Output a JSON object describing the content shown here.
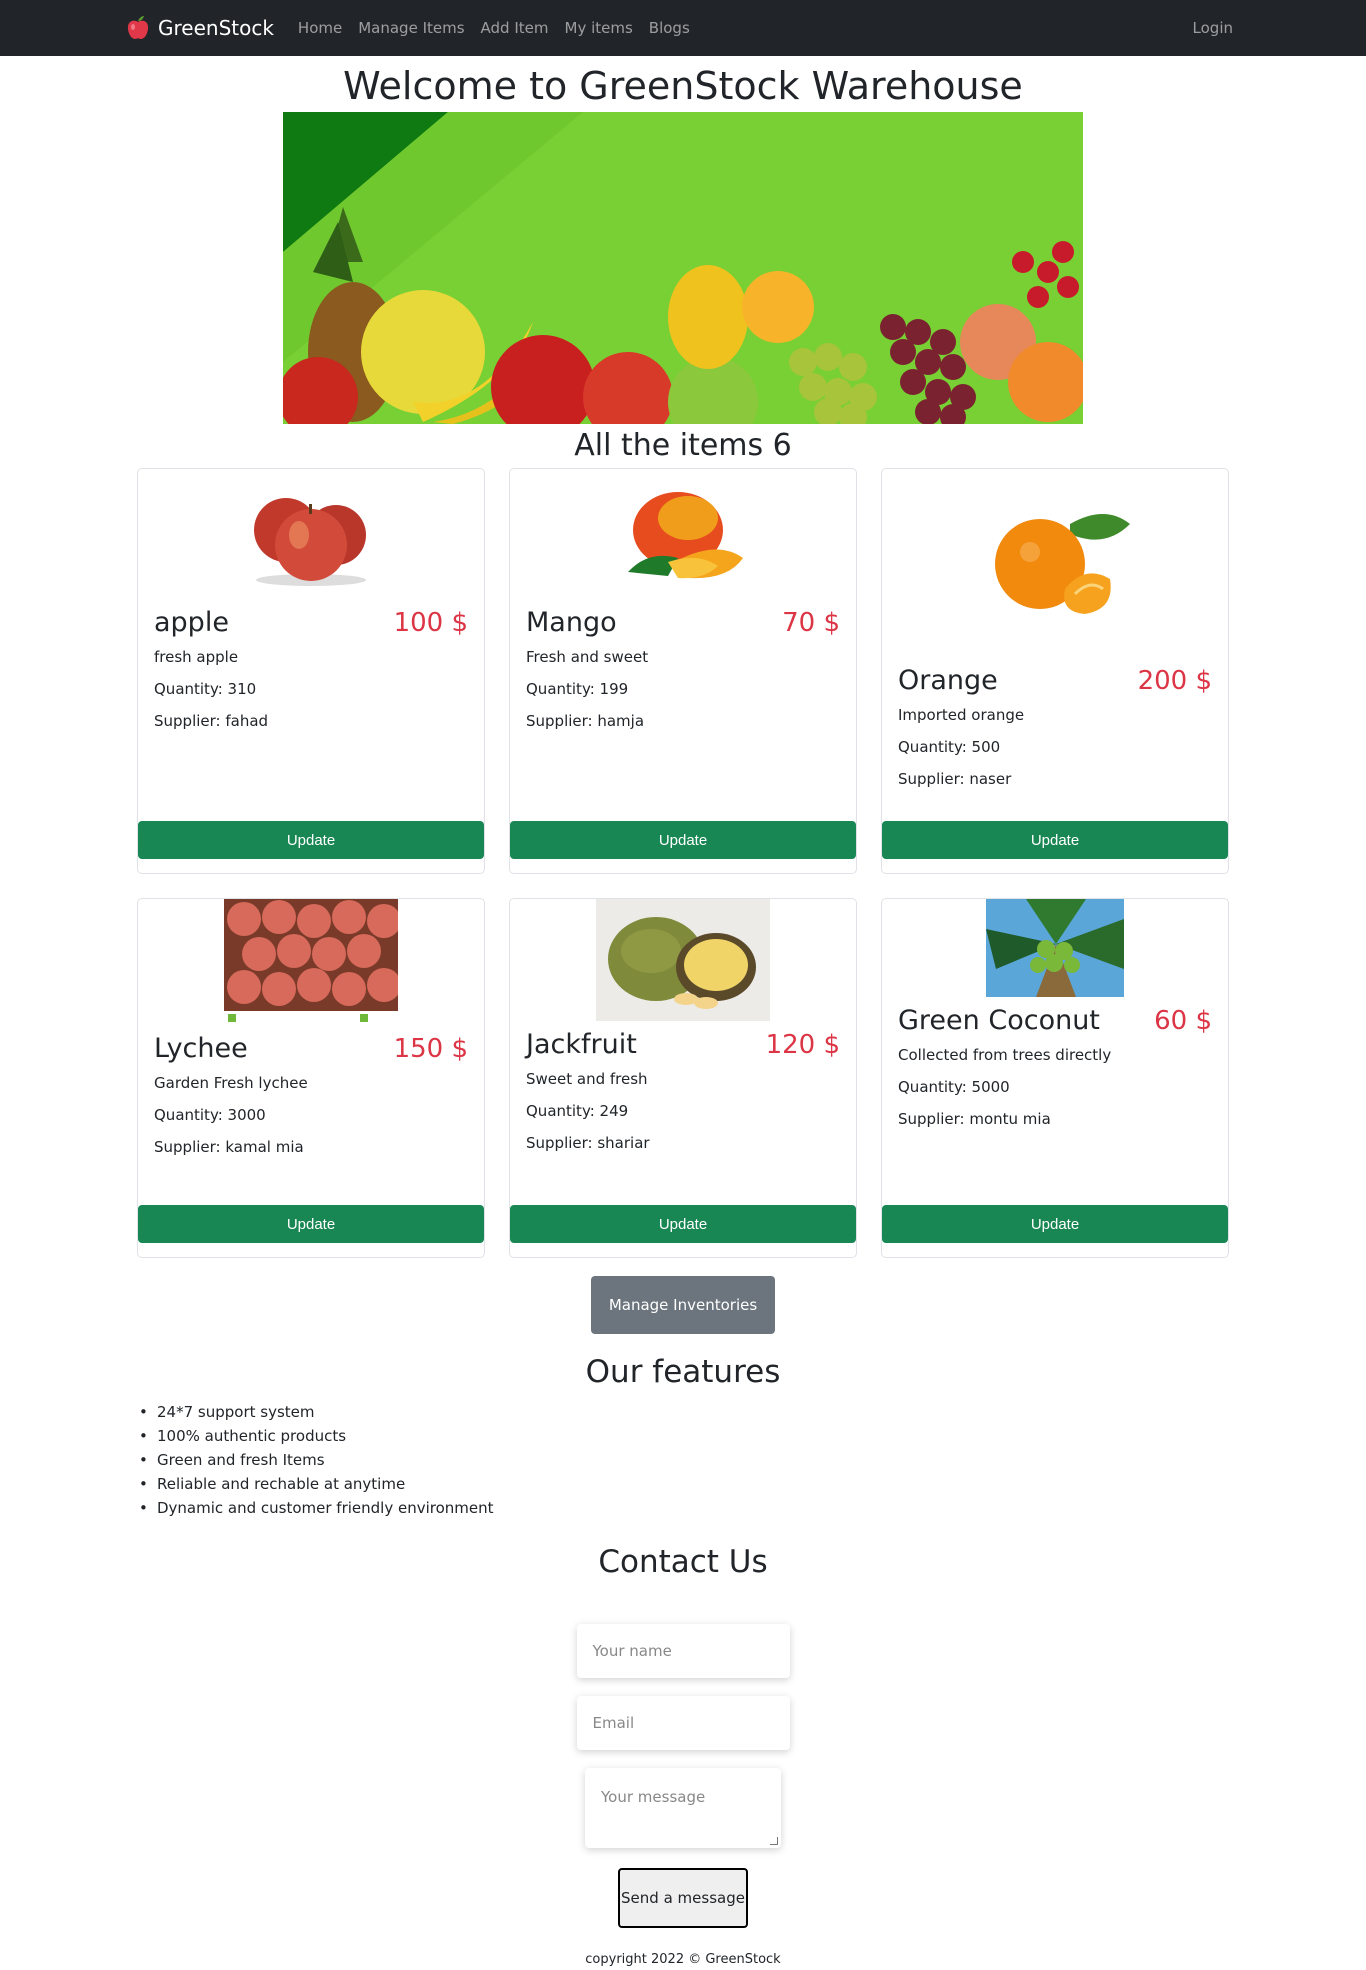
{
  "nav": {
    "brand": "GreenStock",
    "links": [
      "Home",
      "Manage Items",
      "Add Item",
      "My items",
      "Blogs"
    ],
    "login": "Login"
  },
  "hero": {
    "title": "Welcome to GreenStock Warehouse"
  },
  "items_section": {
    "title": "All the items 6"
  },
  "items": [
    {
      "name": "apple",
      "price": "100 $",
      "desc": "fresh apple",
      "qty": "Quantity: 310",
      "supplier": "Supplier: fahad",
      "button": "Update",
      "image": "apple"
    },
    {
      "name": "Mango",
      "price": "70 $",
      "desc": "Fresh and sweet",
      "qty": "Quantity: 199",
      "supplier": "Supplier: hamja",
      "button": "Update",
      "image": "mango"
    },
    {
      "name": "Orange",
      "price": "200 $",
      "desc": "Imported orange",
      "qty": "Quantity: 500",
      "supplier": "Supplier: naser",
      "button": "Update",
      "image": "orange"
    },
    {
      "name": "Lychee",
      "price": "150 $",
      "desc": "Garden Fresh lychee",
      "qty": "Quantity: 3000",
      "supplier": "Supplier: kamal mia",
      "button": "Update",
      "image": "lychee"
    },
    {
      "name": "Jackfruit",
      "price": "120 $",
      "desc": "Sweet and fresh",
      "qty": "Quantity: 249",
      "supplier": "Supplier: shariar",
      "button": "Update",
      "image": "jackfruit"
    },
    {
      "name": "Green Coconut",
      "price": "60 $",
      "desc": "Collected from trees directly",
      "qty": "Quantity: 5000",
      "supplier": "Supplier: montu mia",
      "button": "Update",
      "image": "coconut"
    }
  ],
  "manage_button": "Manage Inventories",
  "features": {
    "title": "Our features",
    "list": [
      "24*7 support system",
      "100% authentic products",
      "Green and fresh Items",
      "Reliable and rechable at anytime",
      "Dynamic and customer friendly environment"
    ]
  },
  "contact": {
    "title": "Contact Us",
    "name_placeholder": "Your name",
    "email_placeholder": "Email",
    "message_placeholder": "Your message",
    "send": "Send a message"
  },
  "footer": "copyright 2022 © GreenStock",
  "colors": {
    "navbar": "#212529",
    "update_button": "#198754",
    "price": "#dc3545",
    "manage_button": "#6c757d",
    "banner": "#78d034"
  }
}
